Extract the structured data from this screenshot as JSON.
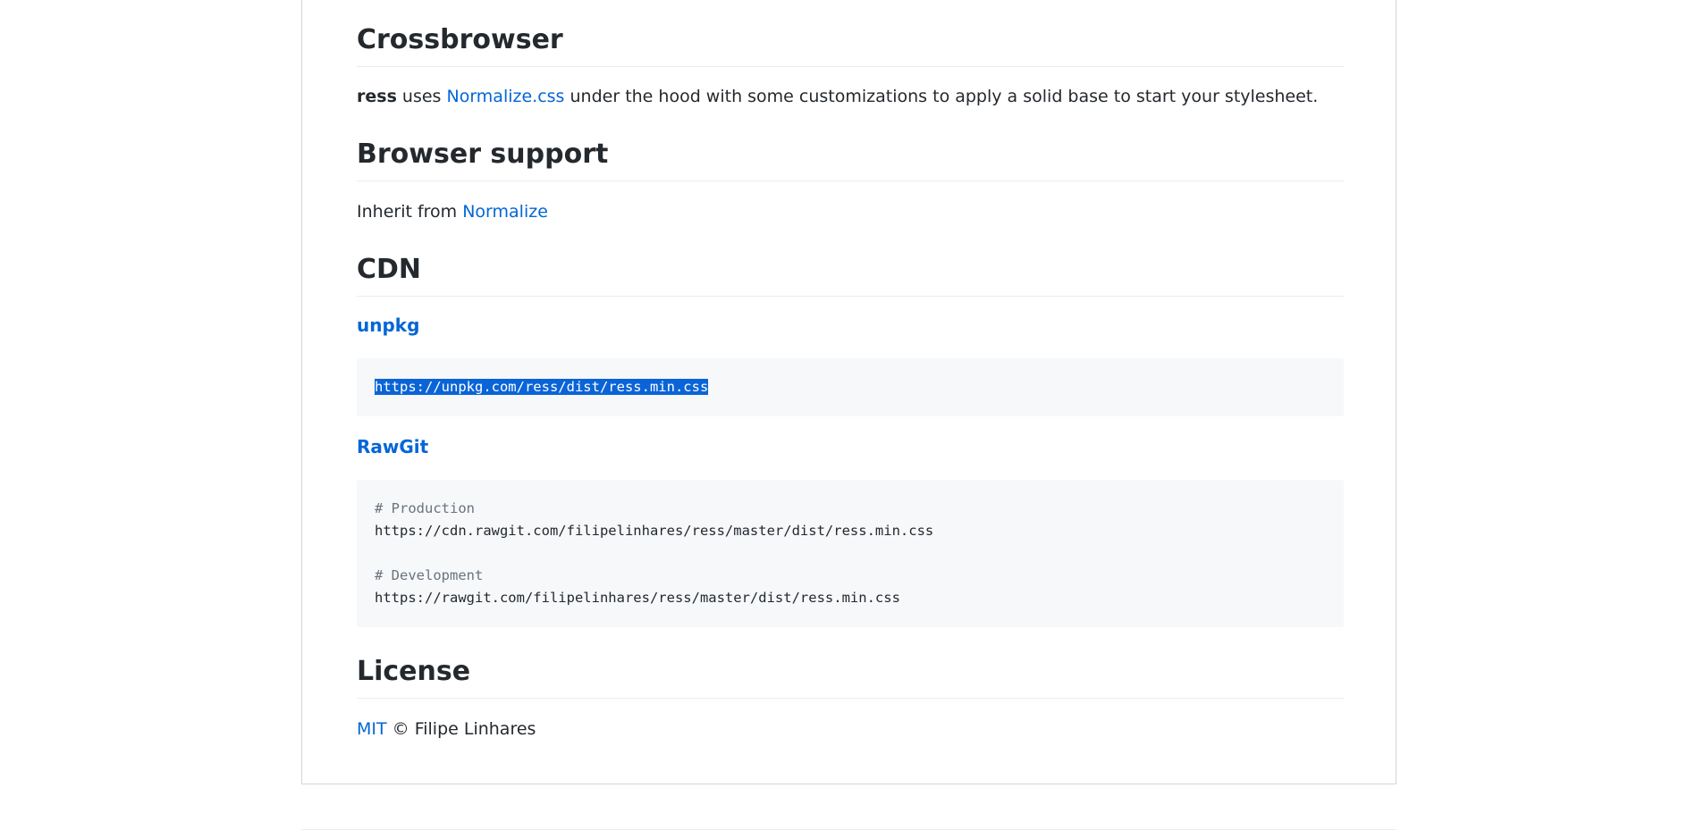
{
  "sections": {
    "crossbrowser": {
      "heading": "Crossbrowser",
      "text_ress": "ress",
      "text_uses": " uses ",
      "link": "Normalize.css",
      "text_rest": " under the hood with some customizations to apply a solid base to start your stylesheet."
    },
    "browser_support": {
      "heading": "Browser support",
      "text": "Inherit from ",
      "link": "Normalize"
    },
    "cdn": {
      "heading": "CDN",
      "unpkg": {
        "title": "unpkg",
        "url": "https://unpkg.com/ress/dist/ress.min.css"
      },
      "rawgit": {
        "title": "RawGit",
        "comment_production": "# Production",
        "url_production": "https://cdn.rawgit.com/filipelinhares/ress/master/dist/ress.min.css",
        "comment_development": "# Development",
        "url_development": "https://rawgit.com/filipelinhares/ress/master/dist/ress.min.css"
      }
    },
    "license": {
      "heading": "License",
      "link": "MIT",
      "text": " © Filipe Linhares"
    }
  },
  "colors": {
    "link": "#0366d6",
    "selection": "#0a64d7",
    "code_bg": "#f6f8fa"
  }
}
